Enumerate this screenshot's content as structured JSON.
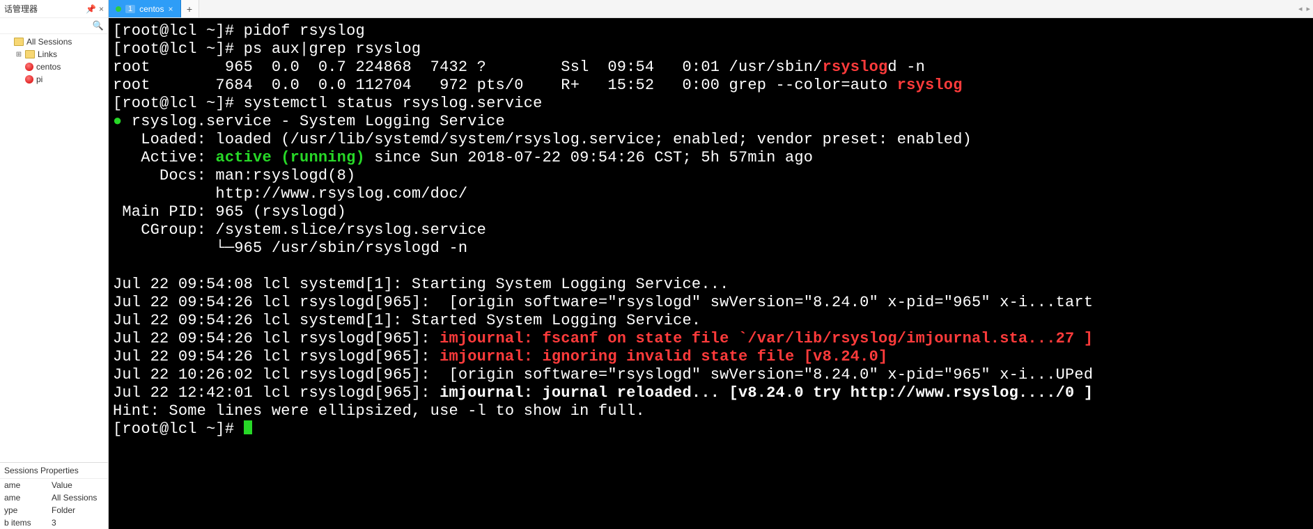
{
  "sidebar": {
    "title": "话管理器",
    "tree": {
      "all_sessions": "All Sessions",
      "links": "Links",
      "centos": "centos",
      "pi": "pi"
    },
    "props_title": "Sessions Properties",
    "props": {
      "h_name": "ame",
      "h_value": "Value",
      "r1k": "ame",
      "r1v": "All Sessions",
      "r2k": "ype",
      "r2v": "Folder",
      "r3k": "b items",
      "r3v": "3"
    }
  },
  "tab": {
    "num": "1",
    "label": "centos"
  },
  "term": {
    "p1": "[root@lcl ~]# ",
    "c1": "pidof rsyslog",
    "p2": "[root@lcl ~]# ",
    "c2": "ps aux|grep rsyslog",
    "ps1a": "root        965  0.0  0.7 224868  7432 ?        Ssl  09:54   0:01 /usr/sbin/",
    "ps1b": "rsyslog",
    "ps1c": "d -n",
    "ps2a": "root       7684  0.0  0.0 112704   972 pts/0    R+   15:52   0:00 grep --color=auto ",
    "ps2b": "rsyslog",
    "p3": "[root@lcl ~]# ",
    "c3": "systemctl status rsyslog.service",
    "svc_bullet": "●",
    "svc_name": " rsyslog.service - System Logging Service",
    "loaded": "   Loaded: loaded (/usr/lib/systemd/system/rsyslog.service; enabled; vendor preset: enabled)",
    "active_lbl": "   Active: ",
    "active_val": "active (running)",
    "active_rest": " since Sun 2018-07-22 09:54:26 CST; 5h 57min ago",
    "docs1": "     Docs: man:rsyslogd(8)",
    "docs2": "           http://www.rsyslog.com/doc/",
    "mainpid": " Main PID: 965 (rsyslogd)",
    "cgroup1": "   CGroup: /system.slice/rsyslog.service",
    "cgroup2": "           └─965 /usr/sbin/rsyslogd -n",
    "blank": "",
    "log1": "Jul 22 09:54:08 lcl systemd[1]: Starting System Logging Service...",
    "log2": "Jul 22 09:54:26 lcl rsyslogd[965]:  [origin software=\"rsyslogd\" swVersion=\"8.24.0\" x-pid=\"965\" x-i...tart",
    "log3": "Jul 22 09:54:26 lcl systemd[1]: Started System Logging Service.",
    "log4a": "Jul 22 09:54:26 lcl rsyslogd[965]: ",
    "log4b": "imjournal: fscanf on state file `/var/lib/rsyslog/imjournal.sta...27 ]",
    "log5a": "Jul 22 09:54:26 lcl rsyslogd[965]: ",
    "log5b": "imjournal: ignoring invalid state file [v8.24.0]",
    "log6": "Jul 22 10:26:02 lcl rsyslogd[965]:  [origin software=\"rsyslogd\" swVersion=\"8.24.0\" x-pid=\"965\" x-i...UPed",
    "log7a": "Jul 22 12:42:01 lcl rsyslogd[965]: ",
    "log7b": "imjournal: journal reloaded... [v8.24.0 try http://www.rsyslog..../0 ]",
    "hint": "Hint: Some lines were ellipsized, use -l to show in full.",
    "p4": "[root@lcl ~]# "
  }
}
